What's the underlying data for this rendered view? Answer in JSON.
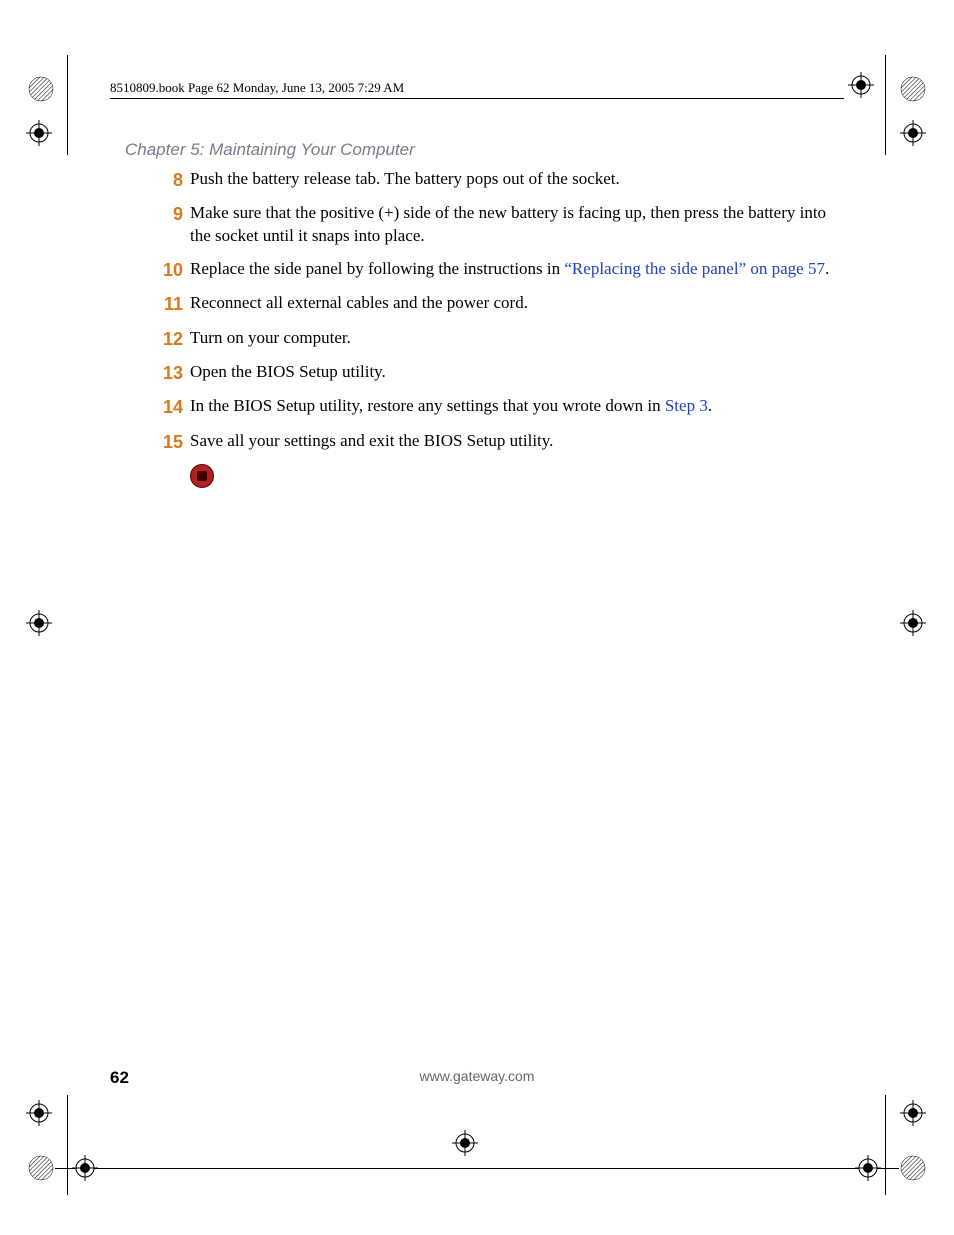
{
  "header": {
    "running_head": "8510809.book  Page 62  Monday, June 13, 2005  7:29 AM"
  },
  "chapter": {
    "title": "Chapter 5: Maintaining Your Computer"
  },
  "steps": [
    {
      "num": "8",
      "text": "Push the battery release tab. The battery pops out of the socket."
    },
    {
      "num": "9",
      "text": "Make sure that the positive (+) side of the new battery is facing up, then press the battery into the socket until it snaps into place."
    },
    {
      "num": "10",
      "text_pre": "Replace the side panel by following the instructions in ",
      "link": "“Replacing the side panel” on page 57",
      "text_post": "."
    },
    {
      "num": "11",
      "text": "Reconnect all external cables and the power cord."
    },
    {
      "num": "12",
      "text": "Turn on your computer."
    },
    {
      "num": "13",
      "text": "Open the BIOS Setup utility."
    },
    {
      "num": "14",
      "text_pre": "In the BIOS Setup utility, restore any settings that you wrote down in ",
      "link": "Step 3",
      "text_post": "."
    },
    {
      "num": "15",
      "text": "Save all your settings and exit the BIOS Setup utility."
    }
  ],
  "footer": {
    "page_number": "62",
    "url": "www.gateway.com"
  }
}
